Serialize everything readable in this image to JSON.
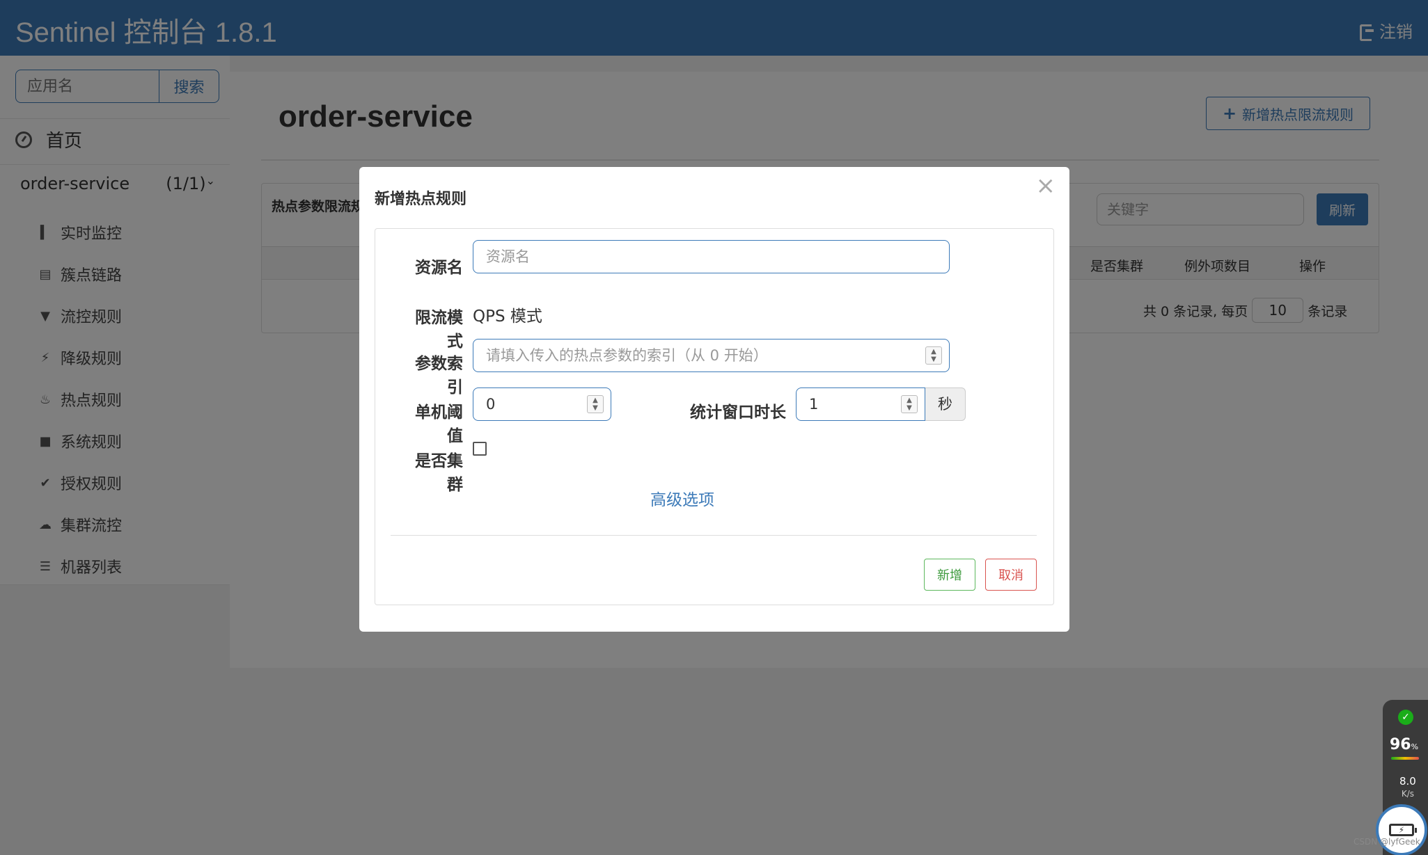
{
  "header": {
    "title": "Sentinel 控制台 1.8.1",
    "logout_label": "注销"
  },
  "sidebar": {
    "search_placeholder": "应用名",
    "search_button": "搜索",
    "home_label": "首页",
    "app": {
      "name": "order-service",
      "count": "(1/1)"
    },
    "menu": [
      {
        "label": "实时监控",
        "icon": "bar-chart-icon"
      },
      {
        "label": "簇点链路",
        "icon": "list-icon"
      },
      {
        "label": "流控规则",
        "icon": "filter-icon"
      },
      {
        "label": "降级规则",
        "icon": "flash-icon"
      },
      {
        "label": "热点规则",
        "icon": "fire-icon"
      },
      {
        "label": "系统规则",
        "icon": "lock-icon"
      },
      {
        "label": "授权规则",
        "icon": "check-icon"
      },
      {
        "label": "集群流控",
        "icon": "cloud-icon"
      },
      {
        "label": "机器列表",
        "icon": "th-list-icon"
      }
    ]
  },
  "main": {
    "page_title": "order-service",
    "add_rule_button": "新增热点限流规则",
    "panel_title": "热点参数限流规",
    "keyword_placeholder": "关键字",
    "refresh_button": "刷新",
    "columns": [
      "是否集群",
      "例外项数目",
      "操作"
    ],
    "pager": {
      "prefix": "共 0 条记录, 每页",
      "page_size": "10",
      "suffix": "条记录"
    }
  },
  "modal": {
    "title": "新增热点规则",
    "close": "×",
    "resource_label": "资源名",
    "resource_placeholder": "资源名",
    "mode_label": "限流模式",
    "mode_value": "QPS 模式",
    "param_label": "参数索引",
    "param_placeholder": "请填入传入的热点参数的索引（从 0 开始）",
    "threshold_label": "单机阈值",
    "threshold_value": "0",
    "window_label": "统计窗口时长",
    "window_value": "1",
    "window_unit": "秒",
    "cluster_label": "是否集群",
    "advanced_link": "高级选项",
    "submit_button": "新增",
    "cancel_button": "取消"
  },
  "widget": {
    "percent": "96",
    "percent_unit": "%",
    "speed": "8.0",
    "speed_unit": "K/s"
  },
  "watermark": "CSDN @lyfGeek"
}
